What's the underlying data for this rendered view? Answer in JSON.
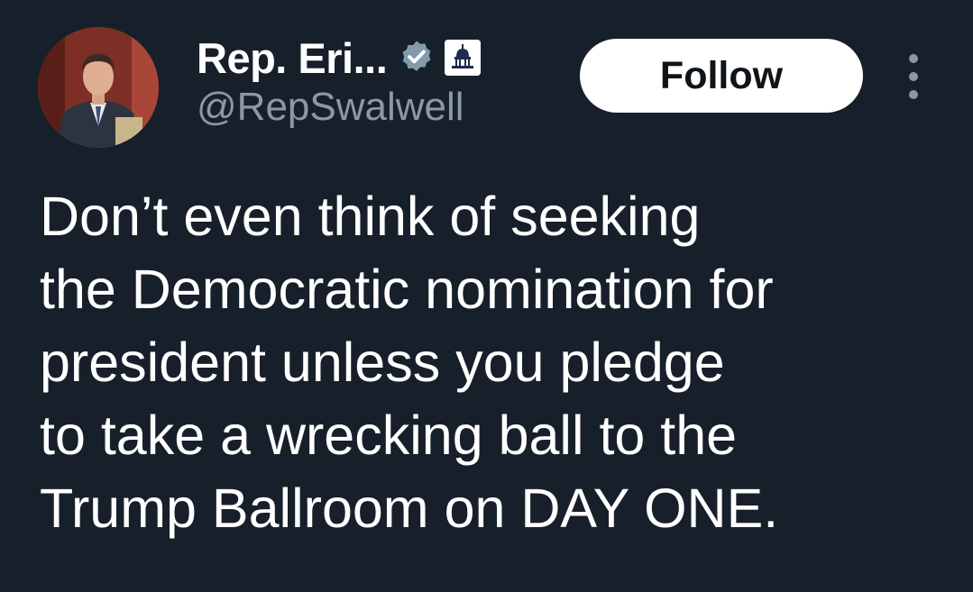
{
  "author": {
    "display_name": "Rep. Eri...",
    "handle": "@RepSwalwell",
    "verified_icon": "gray-verified-badge-icon",
    "affiliation_icon": "capitol-building-affiliate-icon"
  },
  "actions": {
    "follow_label": "Follow",
    "more_icon": "more-vertical-icon"
  },
  "tweet": {
    "lines": [
      "Don’t even think of seeking",
      "the Democratic nomination for",
      "president unless you pledge",
      "to take a wrecking ball to the",
      "Trump Ballroom on DAY ONE."
    ]
  },
  "colors": {
    "background": "#17202a",
    "text_primary": "#ffffff",
    "text_secondary": "#8b98a5",
    "follow_button_bg": "#ffffff",
    "follow_button_text": "#0f1419"
  }
}
